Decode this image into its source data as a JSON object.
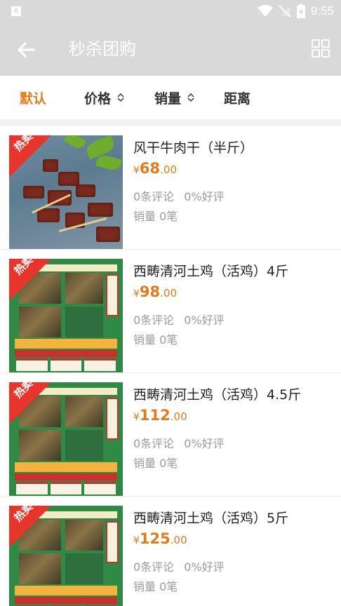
{
  "status_bar": {
    "time": "9:55"
  },
  "app_bar": {
    "title": "秒杀团购"
  },
  "filters": [
    {
      "label": "默认",
      "active": true,
      "sortable": false
    },
    {
      "label": "价格",
      "active": false,
      "sortable": true
    },
    {
      "label": "销量",
      "active": false,
      "sortable": true
    },
    {
      "label": "距离",
      "active": false,
      "sortable": false
    }
  ],
  "products": [
    {
      "badge": "热卖",
      "name": "风干牛肉干（半斤）",
      "currency": "¥",
      "price_int": "68",
      "price_dec": ".00",
      "comments": "0条评论",
      "rating": "0%好评",
      "sales": "销量 0笔",
      "image": "beef-jerky"
    },
    {
      "badge": "热卖",
      "name": "西畴清河土鸡（活鸡）4斤",
      "currency": "¥",
      "price_int": "98",
      "price_dec": ".00",
      "comments": "0条评论",
      "rating": "0%好评",
      "sales": "销量 0笔",
      "image": "chicken-poster"
    },
    {
      "badge": "热卖",
      "name": "西畴清河土鸡（活鸡）4.5斤",
      "currency": "¥",
      "price_int": "112",
      "price_dec": ".00",
      "comments": "0条评论",
      "rating": "0%好评",
      "sales": "销量 0笔",
      "image": "chicken-poster"
    },
    {
      "badge": "热卖",
      "name": "西畴清河土鸡（活鸡）5斤",
      "currency": "¥",
      "price_int": "125",
      "price_dec": ".00",
      "comments": "0条评论",
      "rating": "0%好评",
      "sales": "销量 0笔",
      "image": "chicken-poster"
    }
  ],
  "colors": {
    "accent": "#e07b1f",
    "badge": "#e8352b",
    "toolbar": "#d9d9d9"
  }
}
